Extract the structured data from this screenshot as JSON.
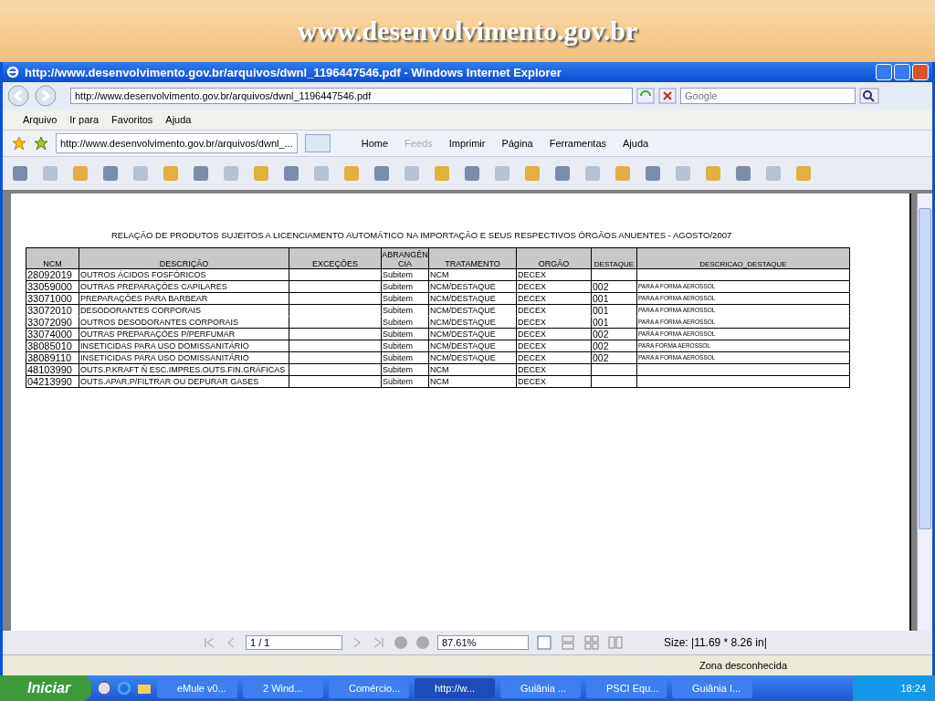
{
  "slide_title": "www.desenvolvimento.gov.br",
  "window": {
    "title": "http://www.desenvolvimento.gov.br/arquivos/dwnl_1196447546.pdf - Windows Internet Explorer"
  },
  "address_bar": {
    "value": "http://www.desenvolvimento.gov.br/arquivos/dwnl_1196447546.pdf"
  },
  "search": {
    "placeholder": "Google"
  },
  "menu": [
    "Arquivo",
    "Ir para",
    "Favoritos",
    "Ajuda"
  ],
  "browser_tab": {
    "label": "http://www.desenvolvimento.gov.br/arquivos/dwnl_..."
  },
  "command_bar": [
    {
      "label": "Home",
      "disabled": false
    },
    {
      "label": "Feeds",
      "disabled": true
    },
    {
      "label": "Imprimir",
      "disabled": false
    },
    {
      "label": "Página",
      "disabled": false
    },
    {
      "label": "Ferramentas",
      "disabled": false
    },
    {
      "label": "Ajuda",
      "disabled": false
    }
  ],
  "document": {
    "heading": "RELAÇÃO DE PRODUTOS SUJEITOS A LICENCIAMENTO  AUTOMÁTICO NA IMPORTAÇÃO E SEUS RESPECTIVOS ÓRGÃOS ANUENTES - AGOSTO/2007",
    "columns": [
      "NCM",
      "DESCRIÇÃO",
      "EXCEÇÕES",
      "ABRANGÊN CIA",
      "TRATAMENTO",
      "ORGÃO",
      "DESTAQUE",
      "DESCRICAO_DESTAQUE"
    ],
    "rows": [
      {
        "cells": [
          "28092019",
          "OUTROS ÁCIDOS FOSFÓRICOS",
          "",
          "Subitem",
          "NCM",
          "DECEX",
          "",
          ""
        ],
        "merged_with_next": false
      },
      {
        "cells": [
          "33059000",
          "OUTRAS PREPARAÇÕES CAPILARES",
          "",
          "Subitem",
          "NCM/DESTAQUE",
          "DECEX",
          "002",
          "PARA A FORMA AEROSSOL"
        ],
        "merged_with_next": false
      },
      {
        "cells": [
          "33071000",
          "PREPARAÇÕES PARA BARBEAR",
          "",
          "Subitem",
          "NCM/DESTAQUE",
          "DECEX",
          "001",
          "PARA A FORMA AEROSSOL"
        ],
        "merged_with_next": false
      },
      {
        "cells": [
          "33072010",
          "DESODORANTES CORPORAIS",
          "",
          "Subitem",
          "NCM/DESTAQUE",
          "DECEX",
          "001",
          "PARA A FORMA AEROSSOL"
        ],
        "merged_with_next": true
      },
      {
        "cells": [
          "33072090",
          "OUTROS DESODORANTES CORPORAIS",
          "",
          "Subitem",
          "NCM/DESTAQUE",
          "DECEX",
          "001",
          "PARA A FORMA AEROSSOL"
        ],
        "merged_with_next": false
      },
      {
        "cells": [
          "33074000",
          "OUTRAS PREPARAÇÕES P/PERFUMAR",
          "",
          "Subitem",
          "NCM/DESTAQUE",
          "DECEX",
          "002",
          "PARA A FORMA AEROSSOL"
        ],
        "merged_with_next": false
      },
      {
        "cells": [
          "38085010",
          "INSETICIDAS PARA USO DOMISSANITÁRIO",
          "",
          "Subitem",
          "NCM/DESTAQUE",
          "DECEX",
          "002",
          "PARA FORMA AEROSSOL"
        ],
        "merged_with_next": false
      },
      {
        "cells": [
          "38089110",
          "INSETICIDAS PARA USO DOMISSANITÁRIO",
          "",
          "Subitem",
          "NCM/DESTAQUE",
          "DECEX",
          "002",
          "PARA A FORMA AEROSSOL"
        ],
        "merged_with_next": false
      },
      {
        "cells": [
          "48103990",
          "OUTS.P.KRAFT Ñ ESC.IMPRES.OUTS.FIN.GRÁFICAS",
          "",
          "Subitem",
          "NCM",
          "DECEX",
          "",
          ""
        ],
        "merged_with_next": false
      },
      {
        "cells": [
          "04213990",
          "OUTS.APAR.P/FILTRAR OU DEPURAR GASES",
          "",
          "Subitem",
          "NCM",
          "DECEX",
          "",
          ""
        ],
        "merged_with_next": false
      }
    ]
  },
  "nav_bar": {
    "page": "1 / 1",
    "zoom": "87.61%",
    "size": "Size: |11.69 * 8.26 in|"
  },
  "status_bar": {
    "zone": "Zona desconhecida"
  },
  "taskbar": {
    "start": "Iniciar",
    "items": [
      {
        "label": "eMule v0...",
        "selected": false
      },
      {
        "label": "2 Wind...",
        "selected": false
      },
      {
        "label": "Comércio...",
        "selected": false
      },
      {
        "label": "http://w...",
        "selected": true
      },
      {
        "label": "Guiânia  ...",
        "selected": false
      },
      {
        "label": "PSCI Equ...",
        "selected": false
      },
      {
        "label": "Guiânia I...",
        "selected": false
      }
    ],
    "clock": "18:24"
  }
}
